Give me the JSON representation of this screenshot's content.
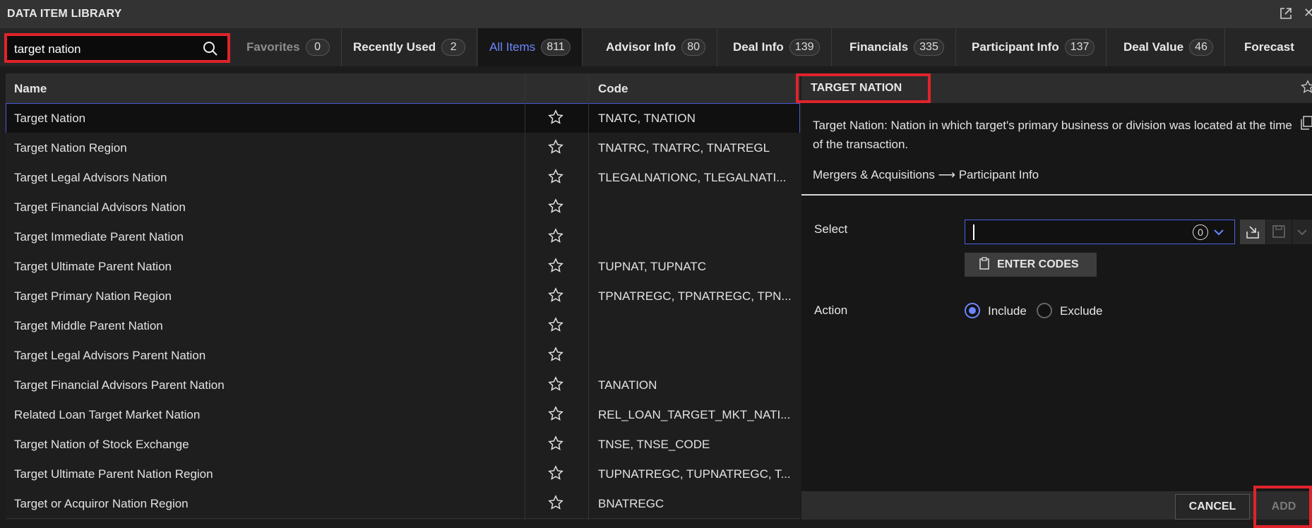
{
  "window": {
    "title": "DATA ITEM LIBRARY"
  },
  "search": {
    "value": "target nation"
  },
  "tabs": [
    {
      "label": "Favorites",
      "count": "0"
    },
    {
      "label": "Recently Used",
      "count": "2"
    },
    {
      "label": "All Items",
      "count": "811"
    },
    {
      "label": "Advisor Info",
      "count": "80"
    },
    {
      "label": "Deal Info",
      "count": "139"
    },
    {
      "label": "Financials",
      "count": "335"
    },
    {
      "label": "Participant Info",
      "count": "137"
    },
    {
      "label": "Deal Value",
      "count": "46"
    },
    {
      "label": "Forecast",
      "count": ""
    }
  ],
  "table": {
    "headers": {
      "name": "Name",
      "code": "Code"
    },
    "rows": [
      {
        "name": "Target Nation",
        "code": "TNATC, TNATION"
      },
      {
        "name": "Target Nation Region",
        "code": "TNATRC, TNATRC, TNATREGL"
      },
      {
        "name": "Target Legal Advisors Nation",
        "code": "TLEGALNATIONC, TLEGALNATI..."
      },
      {
        "name": "Target Financial Advisors Nation",
        "code": ""
      },
      {
        "name": "Target Immediate Parent Nation",
        "code": ""
      },
      {
        "name": "Target Ultimate Parent Nation",
        "code": "TUPNAT, TUPNATC"
      },
      {
        "name": "Target Primary Nation Region",
        "code": "TPNATREGC, TPNATREGC, TPN..."
      },
      {
        "name": "Target Middle Parent Nation",
        "code": ""
      },
      {
        "name": "Target Legal Advisors Parent Nation",
        "code": ""
      },
      {
        "name": "Target Financial Advisors Parent Nation",
        "code": "TANATION"
      },
      {
        "name": "Related Loan Target Market Nation",
        "code": "REL_LOAN_TARGET_MKT_NATI..."
      },
      {
        "name": "Target Nation of Stock Exchange",
        "code": "TNSE, TNSE_CODE"
      },
      {
        "name": "Target Ultimate Parent Nation Region",
        "code": "TUPNATREGC, TUPNATREGC, T..."
      },
      {
        "name": "Target or Acquiror Nation Region",
        "code": "BNATREGC"
      }
    ]
  },
  "detail": {
    "title": "TARGET NATION",
    "description": "Target Nation: Nation in which target's primary business or division was located at the time of the transaction.",
    "breadcrumb": "Mergers & Acquisitions ⟶ Participant Info",
    "select_label": "Select",
    "select_count": "0",
    "enter_codes_label": "ENTER CODES",
    "action_label": "Action",
    "include_label": "Include",
    "exclude_label": "Exclude",
    "cancel_label": "CANCEL",
    "add_label": "ADD"
  },
  "colors": {
    "accent": "#6d86ff",
    "highlight": "#e0232b"
  }
}
